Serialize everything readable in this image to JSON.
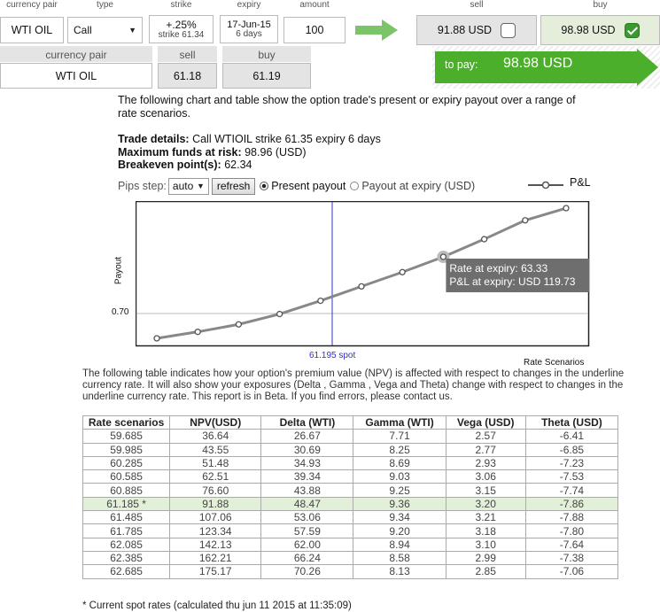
{
  "top_headers": {
    "currency_pair": "currency pair",
    "type": "type",
    "strike": "strike",
    "expiry": "expiry",
    "amount": "amount",
    "sell": "sell",
    "buy": "buy"
  },
  "trade_form": {
    "currency_pair": "WTI OIL",
    "type": "Call",
    "strike_pct": "+.25%",
    "strike_sub": "strike 61.34",
    "expiry_date": "17-Jun-15",
    "expiry_days": "6 days",
    "amount": "100",
    "sell_price": "91.88 USD",
    "buy_price": "98.98 USD",
    "sell_checked": false,
    "buy_checked": true
  },
  "quote": {
    "currency_pair_label": "currency pair",
    "sell_label": "sell",
    "buy_label": "buy",
    "currency_pair": "WTI OIL",
    "sell": "61.18",
    "buy": "61.19"
  },
  "pay": {
    "label": "to pay:",
    "amount": "98.98 USD",
    "color": "#4caf2c"
  },
  "intro": "The following chart and table show the option trade's present or expiry payout over a range of rate scenarios.",
  "details": {
    "trade_label": "Trade details:",
    "trade_text": "Call WTIOIL strike 61.35 expiry 6 days",
    "max_label": "Maximum funds at risk:",
    "max_text": "98.96 (USD)",
    "be_label": "Breakeven point(s):",
    "be_text": "62.34"
  },
  "controls": {
    "pips_label": "Pips step:",
    "pips_value": "auto",
    "refresh": "refresh",
    "present": "Present payout",
    "expiry": "Payout at expiry (USD)",
    "present_selected": true
  },
  "chart_data": {
    "type": "line",
    "ylabel": "Payout",
    "xlabel": "Rate Scenarios",
    "series": [
      {
        "name": "P&L",
        "x": [
          59.685,
          59.985,
          60.285,
          60.585,
          60.885,
          61.185,
          61.485,
          61.785,
          62.085,
          62.385,
          62.685
        ],
        "values": [
          36.64,
          43.55,
          51.48,
          62.51,
          76.6,
          91.88,
          107.06,
          123.34,
          142.13,
          162.21,
          175.17
        ]
      }
    ],
    "y_tick": "0.70",
    "spot_label": "61.195 spot",
    "tooltip": {
      "line1": "Rate at expiry: 63.33",
      "line2": "P&L at expiry: USD 119.73",
      "highlight_index": 7
    },
    "colors": {
      "line": "#888888",
      "spot": "#3030c8"
    }
  },
  "table_intro": "The following table indicates how your option's premium value (NPV) is affected with respect to changes in the underline currency rate. It will also show your exposures (Delta , Gamma , Vega and Theta) change with respect to changes in the underline currency rate. This report is in Beta. If you find errors, please contact us.",
  "table": {
    "headers": [
      "Rate scenarios",
      "NPV(USD)",
      "Delta (WTI)",
      "Gamma (WTI)",
      "Vega (USD)",
      "Theta (USD)"
    ],
    "rows": [
      [
        "59.685",
        "36.64",
        "26.67",
        "7.71",
        "2.57",
        "-6.41"
      ],
      [
        "59.985",
        "43.55",
        "30.69",
        "8.25",
        "2.77",
        "-6.85"
      ],
      [
        "60.285",
        "51.48",
        "34.93",
        "8.69",
        "2.93",
        "-7.23"
      ],
      [
        "60.585",
        "62.51",
        "39.34",
        "9.03",
        "3.06",
        "-7.53"
      ],
      [
        "60.885",
        "76.60",
        "43.88",
        "9.25",
        "3.15",
        "-7.74"
      ],
      [
        "61.185 *",
        "91.88",
        "48.47",
        "9.36",
        "3.20",
        "-7.86"
      ],
      [
        "61.485",
        "107.06",
        "53.06",
        "9.34",
        "3.21",
        "-7.88"
      ],
      [
        "61.785",
        "123.34",
        "57.59",
        "9.20",
        "3.18",
        "-7.80"
      ],
      [
        "62.085",
        "142.13",
        "62.00",
        "8.94",
        "3.10",
        "-7.64"
      ],
      [
        "62.385",
        "162.21",
        "66.24",
        "8.58",
        "2.99",
        "-7.38"
      ],
      [
        "62.685",
        "175.17",
        "70.26",
        "8.13",
        "2.85",
        "-7.06"
      ]
    ],
    "spot_row_index": 5,
    "spot_row_color": "#e2efd9"
  },
  "footnote": "* Current spot rates (calculated thu jun 11 2015 at 11:35:09)"
}
